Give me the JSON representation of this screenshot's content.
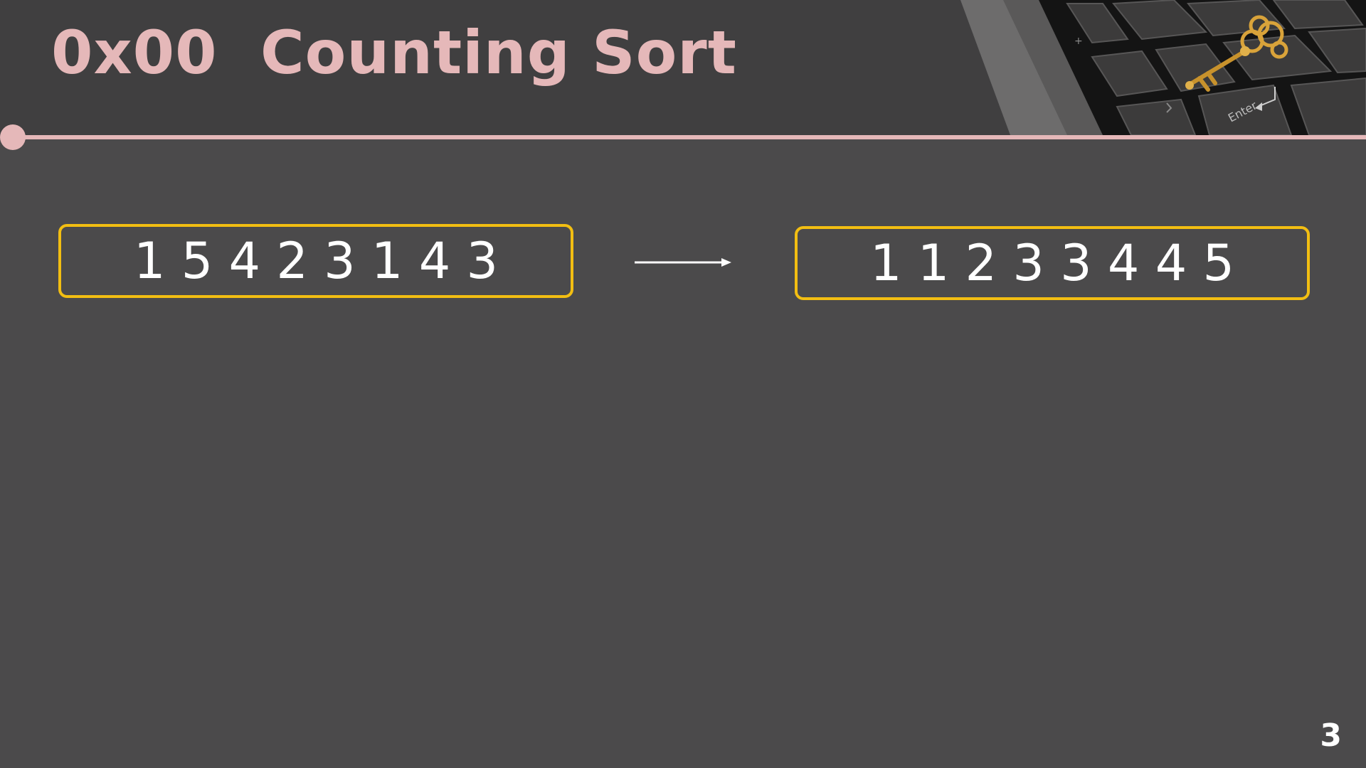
{
  "slide": {
    "title": "0x00  Counting Sort",
    "input_sequence": "1 5 4 2 3 1 4 3",
    "output_sequence": "1 1 2 3 3 4 4 5",
    "page_number": "3",
    "header_image_keycap_label": "Enter"
  },
  "colors": {
    "background": "#4b4a4b",
    "header_background": "#403f40",
    "accent_pink": "#e5b8b9",
    "box_border": "#f2be12",
    "text": "#ffffff"
  },
  "icons": {
    "arrow": "right-arrow-icon",
    "header_image": "keyboard-with-golden-key-photo"
  }
}
